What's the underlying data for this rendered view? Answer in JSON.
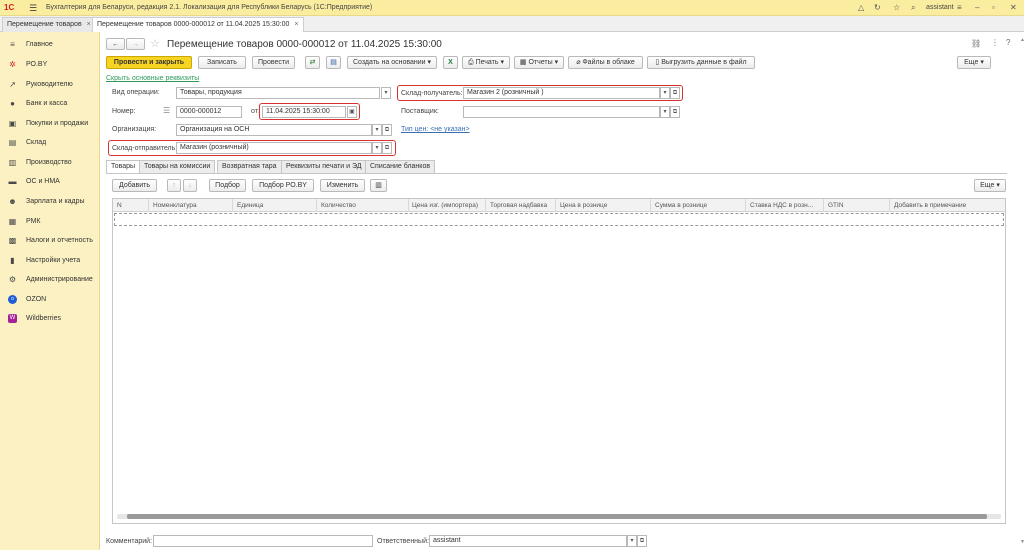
{
  "titlebar": {
    "logo": "1С",
    "title": "Бухгалтерия для Беларуси, редакция 2.1. Локализация для Республики Беларусь   (1С:Предприятие)",
    "user": "assistant"
  },
  "tabs": [
    {
      "label": "Перемещение товаров"
    },
    {
      "label": "Перемещение товаров 0000-000012 от 11.04.2025 15:30:00"
    }
  ],
  "sidebar": {
    "items": [
      {
        "label": "Главное",
        "icon": "menu-icon"
      },
      {
        "label": "РО.BY",
        "icon": "star-icon"
      },
      {
        "label": "Руководителю",
        "icon": "chart-icon"
      },
      {
        "label": "Банк и касса",
        "icon": "bank-icon"
      },
      {
        "label": "Покупки и продажи",
        "icon": "cart-icon"
      },
      {
        "label": "Склад",
        "icon": "warehouse-icon"
      },
      {
        "label": "Производство",
        "icon": "factory-icon"
      },
      {
        "label": "ОС и НМА",
        "icon": "truck-icon"
      },
      {
        "label": "Зарплата и кадры",
        "icon": "people-icon"
      },
      {
        "label": "РМК",
        "icon": "register-icon"
      },
      {
        "label": "Налоги и отчетность",
        "icon": "tax-icon"
      },
      {
        "label": "Настройки учета",
        "icon": "book-icon"
      },
      {
        "label": "Администрирование",
        "icon": "gear-icon"
      },
      {
        "label": "OZON",
        "icon": "ozon-icon"
      },
      {
        "label": "Wildberries",
        "icon": "wb-icon"
      }
    ]
  },
  "doc": {
    "title": "Перемещение товаров 0000-000012 от 11.04.2025 15:30:00"
  },
  "toolbar": {
    "post_close": "Провести и закрыть",
    "save": "Записать",
    "post": "Провести",
    "create_basis": "Создать на основании",
    "print": "Печать",
    "reports": "Отчеты",
    "cloud_files": "Файлы в облаке",
    "export_file": "Выгрузить данные в файл",
    "more": "Еще"
  },
  "form": {
    "hide_link": "Скрыть основные реквизиты",
    "op_type_label": "Вид операции:",
    "op_type_value": "Товары, продукция",
    "number_label": "Номер:",
    "number_value": "0000-000012",
    "from_label": "от:",
    "date_value": "11.04.2025 15:30:00",
    "org_label": "Организация:",
    "org_value": "Организация на ОСН",
    "sender_label": "Склад-отправитель:",
    "sender_value": "Магазин (розничный)",
    "receiver_label": "Склад-получатель:",
    "receiver_value": "Магазин 2 (розничный )",
    "supplier_label": "Поставщик:",
    "supplier_value": "",
    "price_type_link": "Тип цен: <не указан>"
  },
  "form_tabs": [
    {
      "label": "Товары"
    },
    {
      "label": "Товары на комиссии"
    },
    {
      "label": "Возвратная тара"
    },
    {
      "label": "Реквизиты печати и ЭД"
    },
    {
      "label": "Списание бланков"
    }
  ],
  "grid_toolbar": {
    "add": "Добавить",
    "select": "Подбор",
    "select_ro": "Подбор РО.BY",
    "change": "Изменить",
    "more": "Еще"
  },
  "grid": {
    "columns": [
      "N",
      "Номенклатура",
      "Единица",
      "Количество",
      "Цена изг. (импортера)",
      "Торговая надбавка",
      "Цена в рознице",
      "Сумма в рознице",
      "Ставка НДС в розн...",
      "GTIN",
      "Добавить в примечание"
    ]
  },
  "footer": {
    "comment_label": "Комментарий:",
    "comment_value": "",
    "responsible_label": "Ответственный:",
    "responsible_value": "assistant"
  }
}
